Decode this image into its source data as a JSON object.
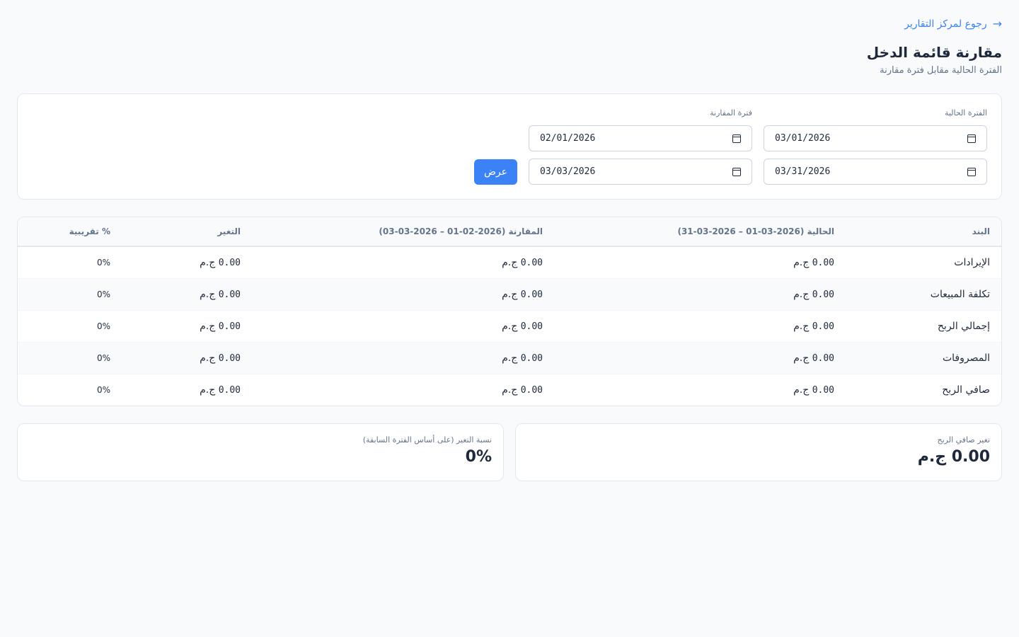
{
  "nav": {
    "back_label": "رجوع لمركز التقارير"
  },
  "header": {
    "title": "مقارنة قائمة الدخل",
    "subtitle": "الفترة الحالية مقابل فترة مقارنة"
  },
  "filters": {
    "current_label": "الفترة الحالية",
    "current_from": "03/01/2026",
    "current_to": "03/31/2026",
    "comparison_label": "فترة المقارنة",
    "comparison_from": "02/01/2026",
    "comparison_to": "03/03/2026",
    "show_label": "عرض"
  },
  "table": {
    "headers": {
      "item": "البند",
      "current": "الحالية (2026-03-01 – 2026-03-31)",
      "comparison": "المقارنة (2026-02-01 – 2026-03-03)",
      "change": "التغير",
      "pct": "% تقريبية"
    },
    "currency": "ج.م",
    "rows": [
      {
        "item": "الإيرادات",
        "current": "0.00",
        "comparison": "0.00",
        "change": "0.00",
        "pct": "0%"
      },
      {
        "item": "تكلفة المبيعات",
        "current": "0.00",
        "comparison": "0.00",
        "change": "0.00",
        "pct": "0%"
      },
      {
        "item": "إجمالي الربح",
        "current": "0.00",
        "comparison": "0.00",
        "change": "0.00",
        "pct": "0%"
      },
      {
        "item": "المصروفات",
        "current": "0.00",
        "comparison": "0.00",
        "change": "0.00",
        "pct": "0%"
      },
      {
        "item": "صافي الربح",
        "current": "0.00",
        "comparison": "0.00",
        "change": "0.00",
        "pct": "0%"
      }
    ]
  },
  "summary": {
    "net_change_label": "تغير صافي الربح",
    "net_change_value": "0.00 ج.م",
    "pct_label": "نسبة التغير (على أساس الفترة السابقة)",
    "pct_value": "0%"
  }
}
